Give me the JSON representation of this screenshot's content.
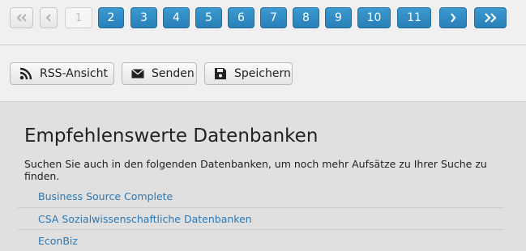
{
  "pagination": {
    "current_page": "1",
    "pages": [
      "2",
      "3",
      "4",
      "5",
      "6",
      "7",
      "8",
      "9",
      "10",
      "11"
    ]
  },
  "toolbar": {
    "rss_label": "RSS-Ansicht",
    "send_label": "Senden",
    "save_label": "Speichern"
  },
  "recommendations": {
    "title": "Empfehlenswerte Datenbanken",
    "intro": "Suchen Sie auch in den folgenden Datenbanken, um noch mehr Aufsätze zu Ihrer Suche zu finden.",
    "databases": [
      "Business Source Complete",
      "CSA Sozialwissenschaftliche Datenbanken",
      "EconBiz"
    ]
  },
  "colors": {
    "accent": "#2a87c3",
    "link": "#2b78b4"
  }
}
